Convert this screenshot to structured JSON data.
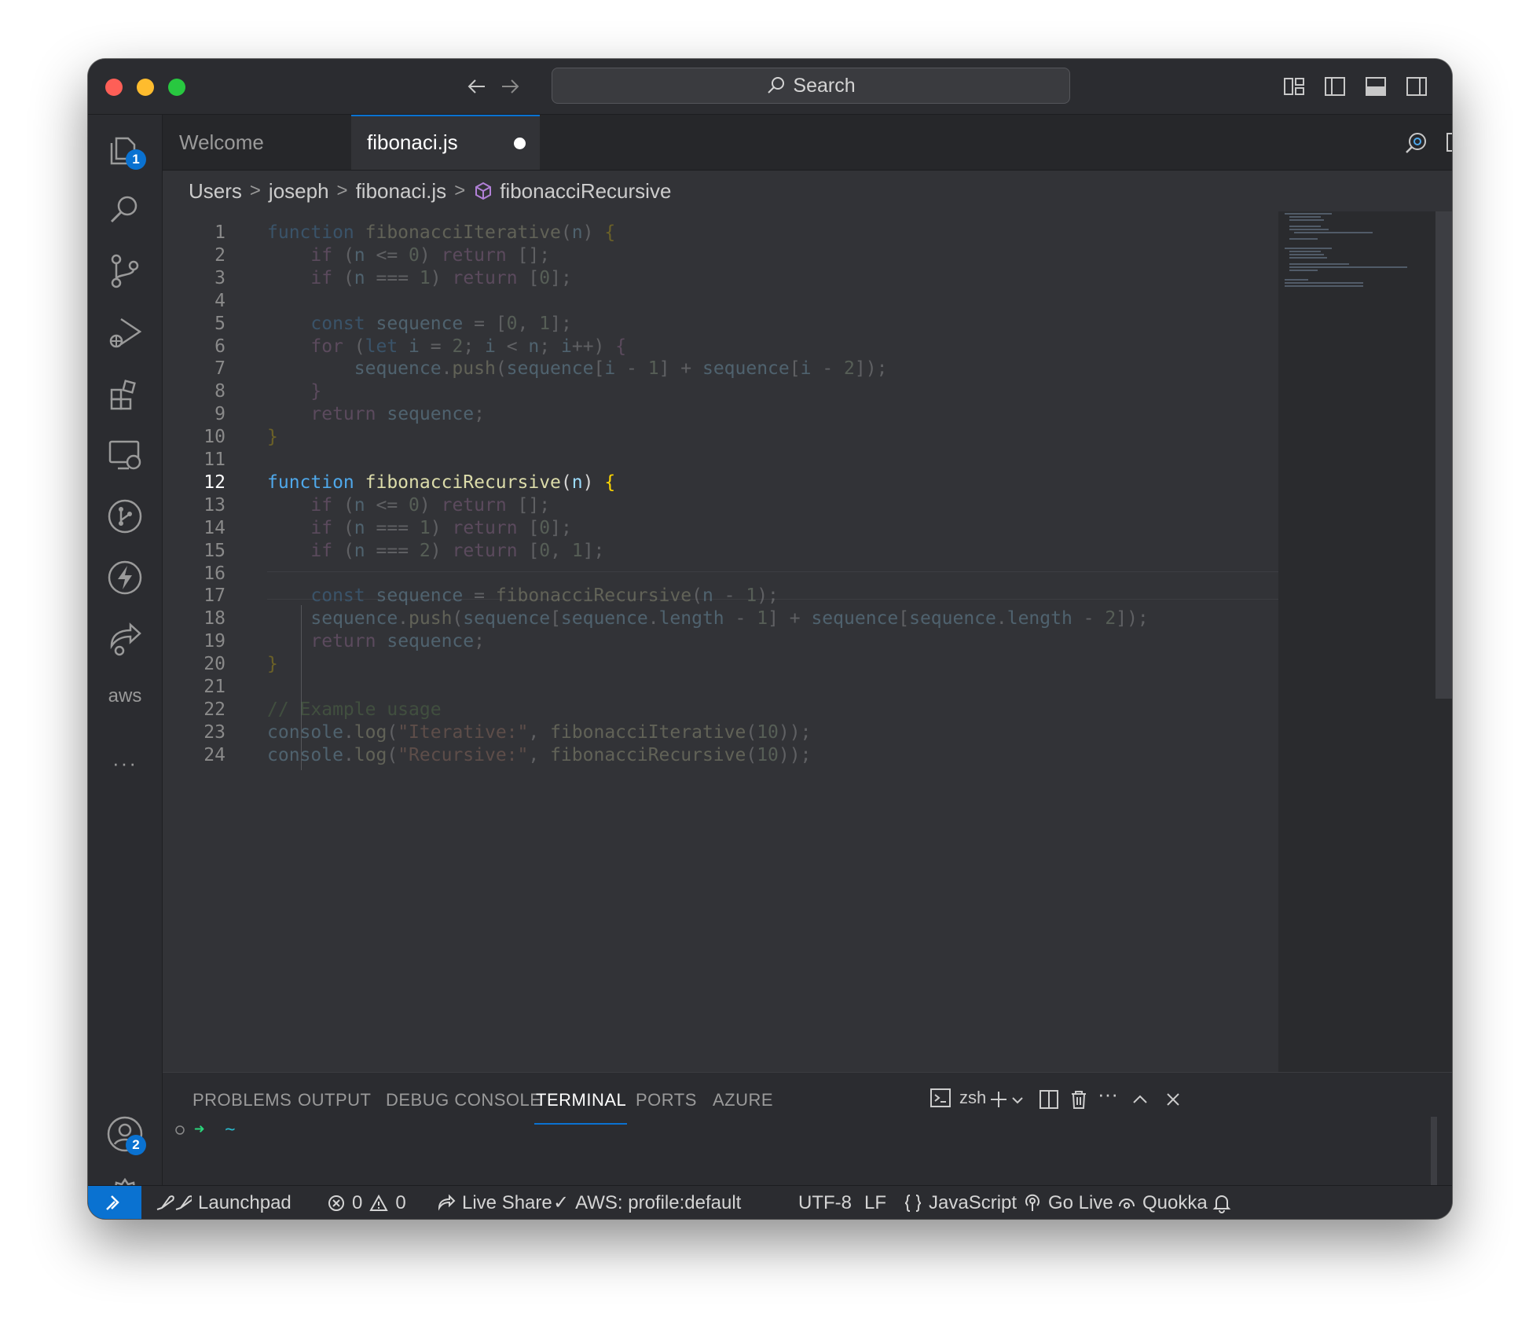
{
  "titlebar": {
    "search_label": "Search"
  },
  "activity_bar": {
    "explorer_badge": "1",
    "accounts_badge": "2",
    "aws_label": "aws",
    "more_label": "···"
  },
  "tabs": [
    {
      "label": "Welcome",
      "active": false
    },
    {
      "label": "fibonaci.js",
      "active": true,
      "dirty": true
    }
  ],
  "breadcrumbs": [
    "Users",
    "joseph",
    "fibonaci.js",
    "fibonacciRecursive"
  ],
  "editor": {
    "current_line": 12,
    "line_numbers": [
      "1",
      "2",
      "3",
      "4",
      "5",
      "6",
      "7",
      "8",
      "9",
      "10",
      "11",
      "12",
      "13",
      "14",
      "15",
      "16",
      "17",
      "18",
      "19",
      "20",
      "21",
      "22",
      "23",
      "24"
    ]
  },
  "code_lines": [
    [
      [
        "kw",
        "function"
      ],
      [
        "pl",
        " "
      ],
      [
        "fn",
        "fibonacciIterative"
      ],
      [
        "pl",
        "("
      ],
      [
        "pa",
        "n"
      ],
      [
        "pl",
        ") "
      ],
      [
        "br",
        "{"
      ]
    ],
    [
      [
        "pl",
        "    "
      ],
      [
        "ctl",
        "if"
      ],
      [
        "pl",
        " ("
      ],
      [
        "pa",
        "n"
      ],
      [
        "pl",
        " <= "
      ],
      [
        "nm",
        "0"
      ],
      [
        "pl",
        ") "
      ],
      [
        "ctl",
        "return"
      ],
      [
        "pl",
        " [];"
      ]
    ],
    [
      [
        "pl",
        "    "
      ],
      [
        "ctl",
        "if"
      ],
      [
        "pl",
        " ("
      ],
      [
        "pa",
        "n"
      ],
      [
        "pl",
        " === "
      ],
      [
        "nm",
        "1"
      ],
      [
        "pl",
        ") "
      ],
      [
        "ctl",
        "return"
      ],
      [
        "pl",
        " ["
      ],
      [
        "nm",
        "0"
      ],
      [
        "pl",
        "];"
      ]
    ],
    [],
    [
      [
        "pl",
        "    "
      ],
      [
        "kw",
        "const"
      ],
      [
        "pl",
        " "
      ],
      [
        "pa",
        "sequence"
      ],
      [
        "pl",
        " = ["
      ],
      [
        "nm",
        "0"
      ],
      [
        "pl",
        ", "
      ],
      [
        "nm",
        "1"
      ],
      [
        "pl",
        "];"
      ]
    ],
    [
      [
        "pl",
        "    "
      ],
      [
        "ctl",
        "for"
      ],
      [
        "pl",
        " ("
      ],
      [
        "kw",
        "let"
      ],
      [
        "pl",
        " "
      ],
      [
        "pa",
        "i"
      ],
      [
        "pl",
        " = "
      ],
      [
        "nm",
        "2"
      ],
      [
        "pl",
        "; "
      ],
      [
        "pa",
        "i"
      ],
      [
        "pl",
        " < "
      ],
      [
        "pa",
        "n"
      ],
      [
        "pl",
        "; "
      ],
      [
        "pa",
        "i"
      ],
      [
        "pl",
        "++) "
      ],
      [
        "ctl",
        "{"
      ]
    ],
    [
      [
        "pl",
        "        "
      ],
      [
        "pa",
        "sequence"
      ],
      [
        "pl",
        "."
      ],
      [
        "fn",
        "push"
      ],
      [
        "pl",
        "("
      ],
      [
        "pa",
        "sequence"
      ],
      [
        "pl",
        "["
      ],
      [
        "pa",
        "i"
      ],
      [
        "pl",
        " - "
      ],
      [
        "nm",
        "1"
      ],
      [
        "pl",
        "] + "
      ],
      [
        "pa",
        "sequence"
      ],
      [
        "pl",
        "["
      ],
      [
        "pa",
        "i"
      ],
      [
        "pl",
        " - "
      ],
      [
        "nm",
        "2"
      ],
      [
        "pl",
        "]);"
      ]
    ],
    [
      [
        "pl",
        "    "
      ],
      [
        "ctl",
        "}"
      ]
    ],
    [
      [
        "pl",
        "    "
      ],
      [
        "ctl",
        "return"
      ],
      [
        "pl",
        " "
      ],
      [
        "pa",
        "sequence"
      ],
      [
        "pl",
        ";"
      ]
    ],
    [
      [
        "br",
        "}"
      ]
    ],
    [],
    [
      [
        "kw",
        "function"
      ],
      [
        "pl",
        " "
      ],
      [
        "fn",
        "fibonacciRecursive"
      ],
      [
        "pl",
        "("
      ],
      [
        "pa",
        "n"
      ],
      [
        "pl",
        ") "
      ],
      [
        "br",
        "{"
      ]
    ],
    [
      [
        "pl",
        "    "
      ],
      [
        "ctl",
        "if"
      ],
      [
        "pl",
        " ("
      ],
      [
        "pa",
        "n"
      ],
      [
        "pl",
        " <= "
      ],
      [
        "nm",
        "0"
      ],
      [
        "pl",
        ") "
      ],
      [
        "ctl",
        "return"
      ],
      [
        "pl",
        " [];"
      ]
    ],
    [
      [
        "pl",
        "    "
      ],
      [
        "ctl",
        "if"
      ],
      [
        "pl",
        " ("
      ],
      [
        "pa",
        "n"
      ],
      [
        "pl",
        " === "
      ],
      [
        "nm",
        "1"
      ],
      [
        "pl",
        ") "
      ],
      [
        "ctl",
        "return"
      ],
      [
        "pl",
        " ["
      ],
      [
        "nm",
        "0"
      ],
      [
        "pl",
        "];"
      ]
    ],
    [
      [
        "pl",
        "    "
      ],
      [
        "ctl",
        "if"
      ],
      [
        "pl",
        " ("
      ],
      [
        "pa",
        "n"
      ],
      [
        "pl",
        " === "
      ],
      [
        "nm",
        "2"
      ],
      [
        "pl",
        ") "
      ],
      [
        "ctl",
        "return"
      ],
      [
        "pl",
        " ["
      ],
      [
        "nm",
        "0"
      ],
      [
        "pl",
        ", "
      ],
      [
        "nm",
        "1"
      ],
      [
        "pl",
        "];"
      ]
    ],
    [],
    [
      [
        "pl",
        "    "
      ],
      [
        "kw",
        "const"
      ],
      [
        "pl",
        " "
      ],
      [
        "pa",
        "sequence"
      ],
      [
        "pl",
        " = "
      ],
      [
        "fn",
        "fibonacciRecursive"
      ],
      [
        "pl",
        "("
      ],
      [
        "pa",
        "n"
      ],
      [
        "pl",
        " - "
      ],
      [
        "nm",
        "1"
      ],
      [
        "pl",
        ");"
      ]
    ],
    [
      [
        "pl",
        "    "
      ],
      [
        "pa",
        "sequence"
      ],
      [
        "pl",
        "."
      ],
      [
        "fn",
        "push"
      ],
      [
        "pl",
        "("
      ],
      [
        "pa",
        "sequence"
      ],
      [
        "pl",
        "["
      ],
      [
        "pa",
        "sequence"
      ],
      [
        "pl",
        "."
      ],
      [
        "pa",
        "length"
      ],
      [
        "pl",
        " - "
      ],
      [
        "nm",
        "1"
      ],
      [
        "pl",
        "] + "
      ],
      [
        "pa",
        "sequence"
      ],
      [
        "pl",
        "["
      ],
      [
        "pa",
        "sequence"
      ],
      [
        "pl",
        "."
      ],
      [
        "pa",
        "length"
      ],
      [
        "pl",
        " - "
      ],
      [
        "nm",
        "2"
      ],
      [
        "pl",
        "]);"
      ]
    ],
    [
      [
        "pl",
        "    "
      ],
      [
        "ctl",
        "return"
      ],
      [
        "pl",
        " "
      ],
      [
        "pa",
        "sequence"
      ],
      [
        "pl",
        ";"
      ]
    ],
    [
      [
        "br",
        "}"
      ]
    ],
    [],
    [
      [
        "cm",
        "// Example usage"
      ]
    ],
    [
      [
        "pa",
        "console"
      ],
      [
        "pl",
        "."
      ],
      [
        "fn",
        "log"
      ],
      [
        "pl",
        "("
      ],
      [
        "st",
        "\"Iterative:\""
      ],
      [
        "pl",
        ", "
      ],
      [
        "fn",
        "fibonacciIterative"
      ],
      [
        "pl",
        "("
      ],
      [
        "nm",
        "10"
      ],
      [
        "pl",
        "));"
      ]
    ],
    [
      [
        "pa",
        "console"
      ],
      [
        "pl",
        "."
      ],
      [
        "fn",
        "log"
      ],
      [
        "pl",
        "("
      ],
      [
        "st",
        "\"Recursive:\""
      ],
      [
        "pl",
        ", "
      ],
      [
        "fn",
        "fibonacciRecursive"
      ],
      [
        "pl",
        "("
      ],
      [
        "nm",
        "10"
      ],
      [
        "pl",
        "));"
      ]
    ]
  ],
  "panel": {
    "tabs": [
      "PROBLEMS",
      "OUTPUT",
      "DEBUG CONSOLE",
      "TERMINAL",
      "PORTS",
      "AZURE"
    ],
    "active_tab": "TERMINAL",
    "shell_label": "zsh",
    "prompt_dir": "~"
  },
  "statusbar": {
    "launchpad": "Launchpad",
    "errors": "0",
    "warnings": "0",
    "live_share": "Live Share",
    "aws_profile": "AWS: profile:default",
    "encoding": "UTF-8",
    "eol": "LF",
    "language": "JavaScript",
    "go_live": "Go Live",
    "quokka": "Quokka"
  },
  "colors": {
    "accent": "#0a72d1",
    "editor_bg": "#323337",
    "chrome_bg": "#2b2c30"
  }
}
